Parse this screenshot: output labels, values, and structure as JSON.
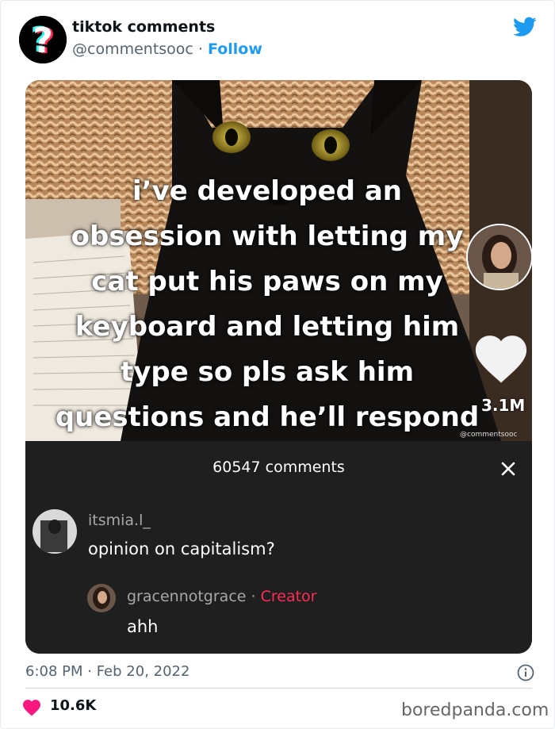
{
  "tweet": {
    "display_name": "tiktok comments",
    "handle": "@commentsooc",
    "separator": " · ",
    "follow_label": "Follow",
    "timestamp": "6:08 PM · Feb 20, 2022",
    "likes": "10.6K"
  },
  "tiktok": {
    "caption_lines": [
      "i’ve developed an",
      "obsession with letting my",
      "cat put his paws on my",
      "keyboard and letting him",
      "type so pls ask him",
      "questions and he’ll respond"
    ],
    "like_count": "3.1M",
    "watermark": "@commentsooc",
    "comments_count": "60547 comments",
    "comment": {
      "user": "itsmia.l_",
      "text": "opinion on capitalism?"
    },
    "reply": {
      "user": "gracennotgrace",
      "separator": " · ",
      "creator_label": "Creator",
      "text": "ahh"
    }
  },
  "source": "boredpanda.com",
  "colors": {
    "twitter_blue": "#1d9bf0",
    "tiktok_red": "#fe2c55",
    "like_pink": "#f91880",
    "comments_bg": "#1f1f1f"
  },
  "icons": [
    "question-mark-logo-icon",
    "twitter-bird-icon",
    "heart-icon",
    "close-icon",
    "info-icon"
  ]
}
